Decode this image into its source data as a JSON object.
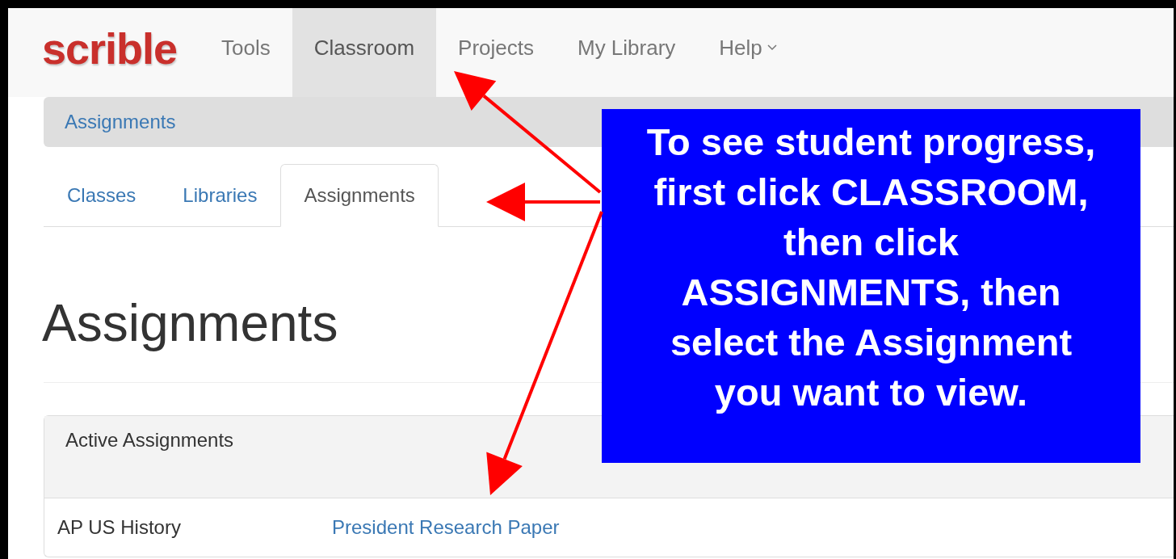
{
  "navbar": {
    "brand": "scrible",
    "items": [
      {
        "label": "Tools",
        "selected": false,
        "dropdown": false
      },
      {
        "label": "Classroom",
        "selected": true,
        "dropdown": false
      },
      {
        "label": "Projects",
        "selected": false,
        "dropdown": false
      },
      {
        "label": "My Library",
        "selected": false,
        "dropdown": false
      },
      {
        "label": "Help",
        "selected": false,
        "dropdown": true
      }
    ]
  },
  "breadcrumb": [
    "Assignments"
  ],
  "tabs": [
    {
      "label": "Classes",
      "selected": false
    },
    {
      "label": "Libraries",
      "selected": false
    },
    {
      "label": "Assignments",
      "selected": true
    }
  ],
  "heading": "Assignments",
  "panel": {
    "title": "Active Assignments",
    "rows": [
      {
        "class": "AP US History",
        "assignment": "President Research Paper"
      }
    ]
  },
  "callout": {
    "lines": [
      "To see student progress,",
      "first click CLASSROOM,",
      "then click",
      "ASSIGNMENTS, then",
      "select the Assignment",
      "you want to view."
    ]
  }
}
